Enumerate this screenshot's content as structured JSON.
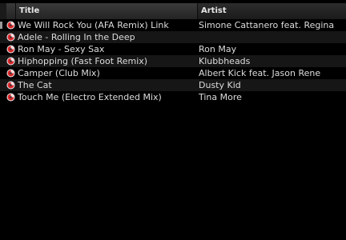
{
  "header": {
    "title_label": "Title",
    "artist_label": "Artist"
  },
  "tracks": [
    {
      "title": "We Will Rock You (AFA Remix)  Link",
      "artist": "Simone Cattanero feat. Regina",
      "selected": true
    },
    {
      "title": "Adele - Rolling In the Deep",
      "artist": "",
      "selected": false
    },
    {
      "title": "Ron May - Sexy Sax",
      "artist": "Ron May",
      "selected": false
    },
    {
      "title": "Hiphopping (Fast Foot Remix)",
      "artist": "Klubbheads",
      "selected": false
    },
    {
      "title": "Camper (Club Mix)",
      "artist": "Albert Kick feat. Jason Rene",
      "selected": false
    },
    {
      "title": "The Cat",
      "artist": "Dusty Kid",
      "selected": false
    },
    {
      "title": "Touch Me (Electro Extended Mix)",
      "artist": "Tina More",
      "selected": false
    }
  ],
  "icons": {
    "track": "music-disc-icon"
  },
  "colors": {
    "background": "#000000",
    "row_alt": "#161616",
    "text": "#dcdcdc",
    "icon_red": "#d8262b"
  }
}
